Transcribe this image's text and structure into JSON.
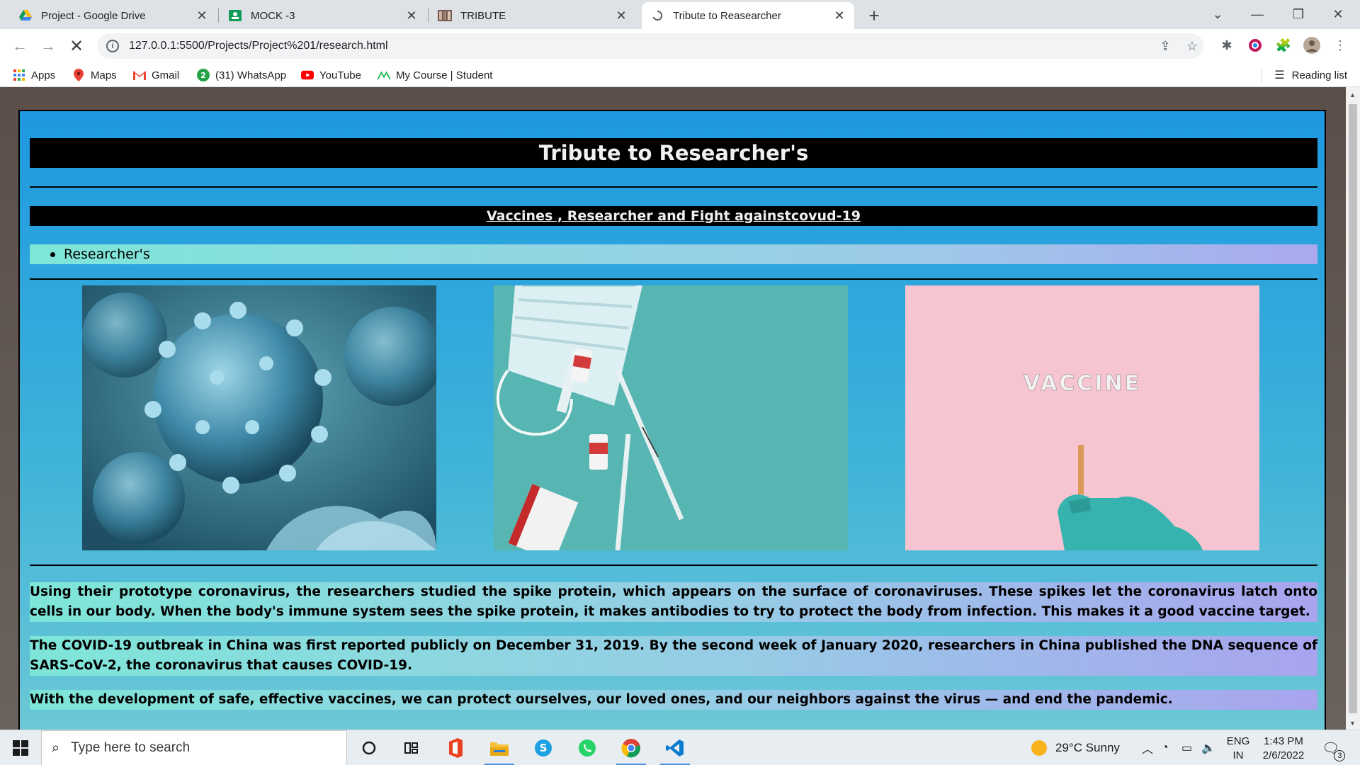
{
  "browser": {
    "tabs": [
      {
        "title": "Project - Google Drive",
        "icon": "google-drive-icon",
        "active": false
      },
      {
        "title": "MOCK -3",
        "icon": "google-classroom-icon",
        "active": false
      },
      {
        "title": "TRIBUTE",
        "icon": "page-thumbnail-icon",
        "active": false
      },
      {
        "title": "Tribute to Reasearcher",
        "icon": "loading-page-icon",
        "active": true
      }
    ],
    "url": "127.0.0.1:5500/Projects/Project%201/research.html",
    "bookmarks": [
      {
        "label": "Apps",
        "icon": "apps-grid-icon"
      },
      {
        "label": "Maps",
        "icon": "maps-pin-icon"
      },
      {
        "label": "Gmail",
        "icon": "gmail-icon"
      },
      {
        "label": "(31) WhatsApp",
        "icon": "whatsapp-badge-icon"
      },
      {
        "label": "YouTube",
        "icon": "youtube-icon"
      },
      {
        "label": "My Course | Student",
        "icon": "course-icon"
      }
    ],
    "reading_list": "Reading list"
  },
  "page": {
    "title": "Tribute to Researcher's",
    "subtitle": "Vaccines , Researcher and Fight againstcovud-19",
    "list_item": "Researcher's",
    "image_3_text": "VACCINE",
    "paragraphs": [
      "Using their prototype coronavirus, the researchers studied the spike protein, which appears on the surface of coronaviruses. These spikes let the coronavirus latch onto cells in our body. When the body's immune system sees the spike protein, it makes antibodies to try to protect the body from infection. This makes it a good vaccine target.",
      "The COVID-19 outbreak in China was first reported publicly on December 31, 2019. By the second week of January 2020, researchers in China published the DNA sequence of SARS-CoV-2, the coronavirus that causes COVID-19.",
      "With the development of safe, effective vaccines, we can protect ourselves, our loved ones, and our neighbors against the virus — and end the pandemic."
    ]
  },
  "taskbar": {
    "search_placeholder": "Type here to search",
    "weather": "29°C  Sunny",
    "lang_top": "ENG",
    "lang_bottom": "IN",
    "time": "1:43 PM",
    "date": "2/6/2022",
    "notifications": "3"
  },
  "colors": {
    "page_gradient_top": "#1e98e0",
    "page_gradient_bottom": "#6fc9d6",
    "banner": "#000000"
  }
}
